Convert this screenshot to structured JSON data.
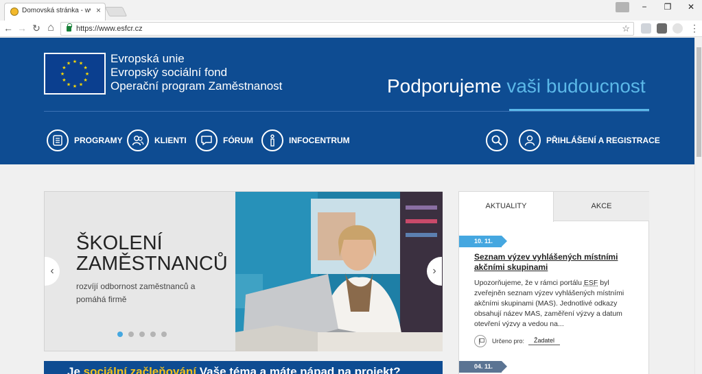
{
  "browser": {
    "tab_title": "Domovská stránka - www",
    "tab_close": "×",
    "url": "https://www.esfcr.cz",
    "window_controls": {
      "minimize": "−",
      "restore": "❐",
      "close": "✕"
    },
    "nav": {
      "back": "←",
      "forward": "→",
      "reload": "↻",
      "home": "⌂",
      "bookmark": "☆",
      "menu": "⋮"
    }
  },
  "header": {
    "eu_lines": [
      "Evropská unie",
      "Evropský sociální fond",
      "Operační program Zaměstnanost"
    ],
    "slogan_part1": "Podporujeme ",
    "slogan_highlight": "vaši budoucnost",
    "menu": [
      {
        "label": "PROGRAMY",
        "icon": "document-list-icon"
      },
      {
        "label": "KLIENTI",
        "icon": "users-icon"
      },
      {
        "label": "FÓRUM",
        "icon": "chat-bubble-icon"
      },
      {
        "label": "INFOCENTRUM",
        "icon": "info-icon"
      }
    ],
    "search_icon": "search-icon",
    "login_label": "PŘIHLÁŠENÍ A REGISTRACE"
  },
  "slider": {
    "title_line1": "ŠKOLENÍ",
    "title_line2": "ZAMĚSTNANCŮ",
    "subtitle": "rozvíjí odbornost zaměstnanců a pomáhá firmě",
    "prev": "‹",
    "next": "›",
    "dots_count": 5,
    "active_dot": 0
  },
  "banner": {
    "prefix": "Je ",
    "highlight": "sociální začleňování",
    "suffix": " Vaše téma a máte nápad na projekt?"
  },
  "news": {
    "tabs": [
      "AKTUALITY",
      "AKCE"
    ],
    "items": [
      {
        "date": "10. 11.",
        "title": "Seznam výzev vyhlášených místními akčními skupinami",
        "body_before": "Upozorňujeme, že v rámci portálu ",
        "body_abbr": "ESF",
        "body_after": " byl zveřejněn seznam výzev vyhlášených místními akčními skupinami (MAS). Jednotlivé odkazy obsahují název MAS, zaměření výzvy a datum otevření výzvy a vedou na...",
        "tag_label": "Určeno pro:",
        "tag_value": "Žadatel"
      },
      {
        "date": "04. 11."
      }
    ]
  },
  "colors": {
    "brand_blue": "#0e4c92",
    "accent": "#5bb8e8",
    "badge": "#45a7e0",
    "banner_highlight": "#f4c21d"
  }
}
